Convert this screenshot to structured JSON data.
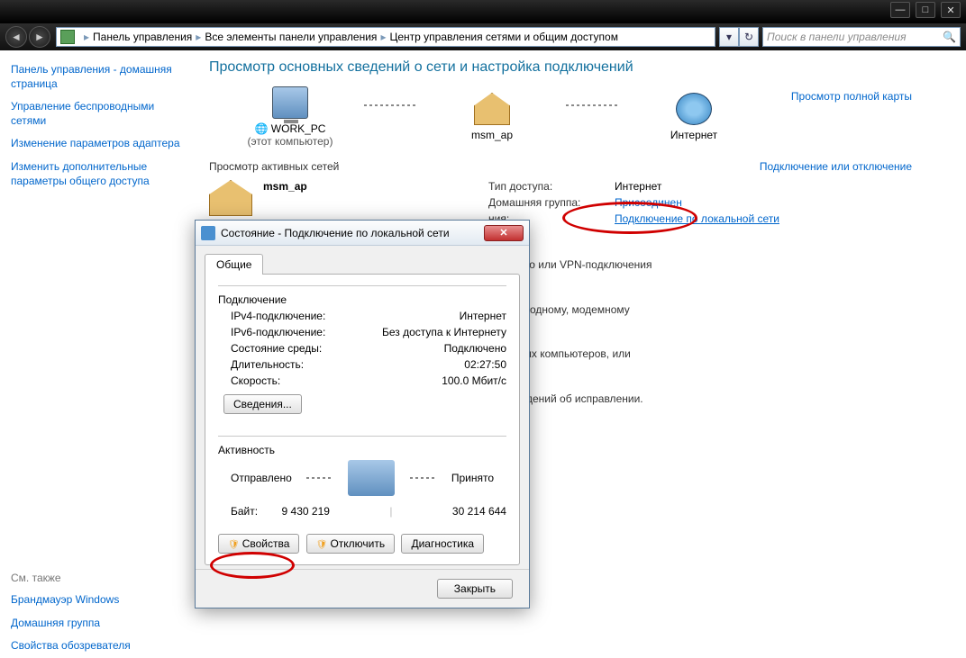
{
  "breadcrumb": {
    "p1": "Панель управления",
    "p2": "Все элементы панели управления",
    "p3": "Центр управления сетями и общим доступом"
  },
  "search_placeholder": "Поиск в панели управления",
  "sidebar": {
    "home": "Панель управления - домашняя страница",
    "wifi": "Управление беспроводными сетями",
    "adapter": "Изменение параметров адаптера",
    "sharing": "Изменить дополнительные параметры общего доступа",
    "see_also": "См. также",
    "fw": "Брандмауэр Windows",
    "hg": "Домашняя группа",
    "ie": "Свойства обозревателя"
  },
  "main": {
    "title": "Просмотр основных сведений о сети и настройка подключений",
    "pc": "WORK_PC",
    "pc_sub": "(этот компьютер)",
    "ap": "msm_ap",
    "inet": "Интернет",
    "full_map": "Просмотр полной карты",
    "active": "Просмотр активных сетей",
    "connect": "Подключение или отключение",
    "net_name": "msm_ap",
    "k_access": "Тип доступа:",
    "v_access": "Интернет",
    "k_hg": "Домашняя группа:",
    "v_hg": "Присоединен",
    "k_cn": "ния:",
    "v_cn": "Подключение по локальной сети",
    "t1": ", прямого или VPN-подключения",
    "t2": "му, проводному, модемному",
    "t3": "к сетевых компьютеров, или",
    "t4": "ние сведений об исправлении."
  },
  "modal": {
    "title": "Состояние - Подключение по локальной сети",
    "tab": "Общие",
    "grp1": "Подключение",
    "ipv4_k": "IPv4-подключение:",
    "ipv4_v": "Интернет",
    "ipv6_k": "IPv6-подключение:",
    "ipv6_v": "Без доступа к Интернету",
    "media_k": "Состояние среды:",
    "media_v": "Подключено",
    "dur_k": "Длительность:",
    "dur_v": "02:27:50",
    "spd_k": "Скорость:",
    "spd_v": "100.0 Мбит/с",
    "details": "Сведения...",
    "grp2": "Активность",
    "sent": "Отправлено",
    "recv": "Принято",
    "bytes_k": "Байт:",
    "bytes_s": "9 430 219",
    "bytes_r": "30 214 644",
    "props": "Свойства",
    "disable": "Отключить",
    "diag": "Диагностика",
    "close": "Закрыть"
  }
}
